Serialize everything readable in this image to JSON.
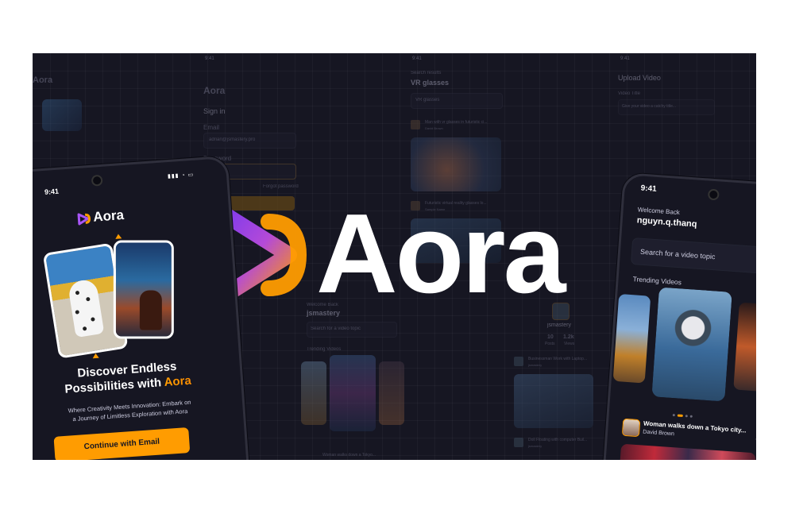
{
  "brand": {
    "name": "Aora"
  },
  "colors": {
    "background": "#161622",
    "accent": "#FF9C01",
    "logo_start": "#8B3CF7",
    "logo_end": "#FF9C01"
  },
  "ghost": {
    "col1_title": "Aora",
    "signin": {
      "time": "9:41",
      "logo": "Aora",
      "heading": "Sign in",
      "email_label": "Email",
      "email_value": "adrian@jsmastery.pro",
      "password_label": "Password",
      "password_value": "••••••••••",
      "forgot": "Forgot password",
      "button": "Log in"
    },
    "search": {
      "time": "9:41",
      "caption": "Search results",
      "query": "VR glasses",
      "input": "VR glasses",
      "item1": "Man with vr glasses in futuristic ci...",
      "item1_sub": "David Brown",
      "item2": "Futuristic virtual reality glasses lo...",
      "item2_sub": "Sample Name"
    },
    "home": {
      "time": "9:41",
      "welcome": "Welcome Back",
      "user": "jsmastery",
      "search": "Search for a video topic",
      "trending": "Trending Videos",
      "latest": "Woman walks down a Tokyo..."
    },
    "upload": {
      "time": "9:41",
      "title": "Upload Video",
      "video_title": "Video Title",
      "placeholder": "Give your video a catchy title..."
    },
    "profile": {
      "user": "jsmastery",
      "posts_value": "10",
      "posts_label": "Posts",
      "views_value": "1.2k",
      "views_label": "Views",
      "item1": "Businessman Work with Laptop...",
      "item1_sub": "jsmastery",
      "item2": "Doll Floating with computer Buil...",
      "item2_sub": "jsmastery"
    }
  },
  "left_phone": {
    "time": "9:41",
    "logo": "Aora",
    "headline_line1": "Discover Endless",
    "headline_line2": "Possibilities with ",
    "headline_accent": "Aora",
    "subtitle_line1": "Where Creativity Meets Innovation: Embark on",
    "subtitle_line2": "a Journey of Limitless Exploration with Aora",
    "cta": "Continue with Email"
  },
  "hero": {
    "wordmark": "Aora"
  },
  "right_phone": {
    "time": "9:41",
    "welcome": "Welcome Back",
    "username": "nguyn.q.thanq",
    "search_placeholder": "Search for a video topic",
    "trending": "Trending Videos",
    "video_title": "Woman walks down a Tokyo city...",
    "video_author": "David Brown",
    "menu": "⋮"
  }
}
